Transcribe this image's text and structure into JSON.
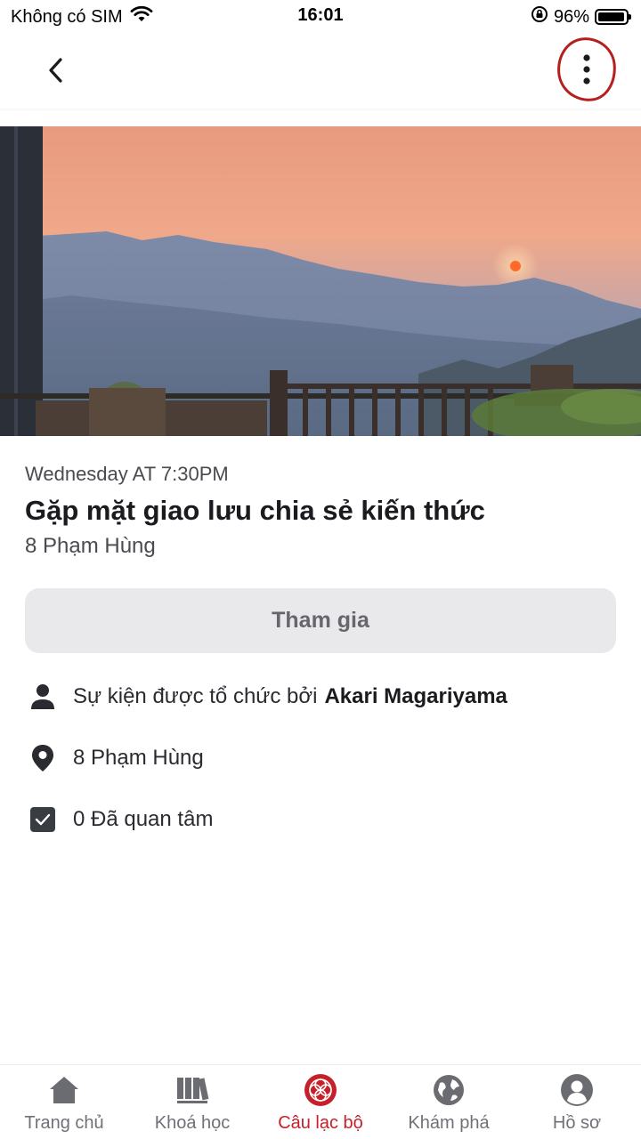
{
  "status_bar": {
    "carrier": "Không có SIM",
    "time": "16:01",
    "battery": "96%",
    "battery_level": 0.96
  },
  "header": {
    "back_icon": "chevron-left-icon",
    "more_icon": "more-vertical-icon"
  },
  "event": {
    "time": "Wednesday AT 7:30PM",
    "title": "Gặp mặt giao lưu chia sẻ kiến thức",
    "address": "8 Phạm Hùng",
    "join_label": "Tham gia"
  },
  "details": {
    "organizer_prefix": "Sự kiện được tổ chức bởi",
    "organizer_name": "Akari Magariyama",
    "location": "8 Phạm Hùng",
    "interested": "0 Đã quan tâm"
  },
  "nav": {
    "items": [
      {
        "label": "Trang chủ",
        "icon": "home-icon"
      },
      {
        "label": "Khoá học",
        "icon": "library-icon"
      },
      {
        "label": "Câu lạc bộ",
        "icon": "club-icon"
      },
      {
        "label": "Khám phá",
        "icon": "globe-icon"
      },
      {
        "label": "Hồ sơ",
        "icon": "profile-icon"
      }
    ],
    "active_index": 2,
    "active_color": "#c8202a"
  },
  "colors": {
    "annotation_ring": "#b3201e",
    "button_bg": "#e9e9ec"
  }
}
